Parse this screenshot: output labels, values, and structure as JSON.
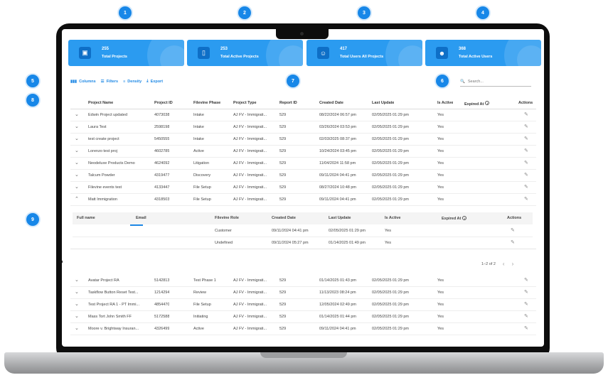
{
  "callouts": [
    "1",
    "2",
    "3",
    "4",
    "5",
    "6",
    "7",
    "8",
    "9"
  ],
  "stats": [
    {
      "value": "255",
      "label": "Total Projects",
      "icon": "archive-icon"
    },
    {
      "value": "253",
      "label": "Total Active Projects",
      "icon": "bookmark-icon"
    },
    {
      "value": "417",
      "label": "Total Users All Projects",
      "icon": "users-icon"
    },
    {
      "value": "368",
      "label": "Total Active Users",
      "icon": "user-badge-icon"
    }
  ],
  "toolbar": {
    "columns": "Columns",
    "filters": "Filters",
    "density": "Density",
    "export": "Export"
  },
  "search": {
    "placeholder": "Search..."
  },
  "table": {
    "headers": [
      "Project Name",
      "Project ID",
      "Filevine Phase",
      "Project Type",
      "Report ID",
      "Created Date",
      "Last Update",
      "Is Active",
      "Expired At",
      "Actions"
    ],
    "rows_top": [
      [
        "Edwin Project updated",
        "4073038",
        "Intake",
        "AJ FV - Immigrati...",
        "529",
        "08/22/2024 06:57 pm",
        "02/05/2025 01:29 pm",
        "Yes"
      ],
      [
        "Laura Test",
        "2598198",
        "Intake",
        "AJ FV - Immigrati...",
        "529",
        "03/26/2024 03:53 pm",
        "02/05/2025 01:29 pm",
        "Yes"
      ],
      [
        "test create project",
        "5450555",
        "Intake",
        "AJ FV - Immigrati...",
        "529",
        "02/03/2025 08:37 pm",
        "02/05/2025 01:29 pm",
        "Yes"
      ],
      [
        "Lorenzo test proj",
        "4602785",
        "Active",
        "AJ FV - Immigrati...",
        "529",
        "10/24/2024 03:45 pm",
        "02/05/2025 01:29 pm",
        "Yes"
      ],
      [
        "Neodeluxe Products Demo",
        "4624092",
        "Litigation",
        "AJ FV - Immigrati...",
        "529",
        "11/04/2024 11:58 pm",
        "02/05/2025 01:29 pm",
        "Yes"
      ],
      [
        "Talcum Powder",
        "4319477",
        "Discovery",
        "AJ FV - Immigrati...",
        "529",
        "09/11/2024 04:41 pm",
        "02/05/2025 01:29 pm",
        "Yes"
      ],
      [
        "Filevine events test",
        "4133447",
        "File Setup",
        "AJ FV - Immigrati...",
        "529",
        "08/27/2024 10:48 pm",
        "02/05/2025 01:29 pm",
        "Yes"
      ],
      [
        "Matt Immigration",
        "4318503",
        "File Setup",
        "AJ FV - Immigrati...",
        "529",
        "09/11/2024 04:41 pm",
        "02/05/2025 01:29 pm",
        "Yes"
      ]
    ],
    "rows_bottom": [
      [
        "Avatar Project RA",
        "5142813",
        "Test Phase 1",
        "AJ FV - Immigrati...",
        "529",
        "01/14/2025 01:43 pm",
        "02/05/2025 01:29 pm",
        "Yes"
      ],
      [
        "Taskflow Button Reset Test...",
        "1214294",
        "Review",
        "AJ FV - Immigrati...",
        "529",
        "11/13/2023 08:24 pm",
        "02/05/2025 01:29 pm",
        "Yes"
      ],
      [
        "Test Project RA 1 - PT Immi...",
        "4854470",
        "File Setup",
        "AJ FV - Immigrati...",
        "529",
        "12/05/2024 02:49 pm",
        "02/05/2025 01:29 pm",
        "Yes"
      ],
      [
        "Mass Tort John Smith FF",
        "5172588",
        "Initiating",
        "AJ FV - Immigrati...",
        "529",
        "01/14/2025 01:44 pm",
        "02/05/2025 01:29 pm",
        "Yes"
      ],
      [
        "Moore v. Brightway Insuran...",
        "4326499",
        "Active",
        "AJ FV - Immigrati...",
        "529",
        "09/11/2024 04:41 pm",
        "02/05/2025 01:29 pm",
        "Yes"
      ]
    ]
  },
  "subtable": {
    "headers": [
      "Full name",
      "Email",
      "Filevine Role",
      "Created Date",
      "Last Update",
      "Is Active",
      "Expired At",
      "Actions"
    ],
    "rows": [
      [
        "",
        "",
        "Customer",
        "09/11/2024 04:41 pm",
        "02/05/2025 01:29 pm",
        "Yes"
      ],
      [
        "",
        "",
        "Undefined",
        "09/11/2024 05:27 pm",
        "01/14/2025 01:49 pm",
        "Yes"
      ]
    ],
    "pagination": "1–2 of 2"
  },
  "colors": {
    "accent": "#1787e8",
    "card": "#2b9bf0",
    "card_icon": "#0e6fc7"
  }
}
